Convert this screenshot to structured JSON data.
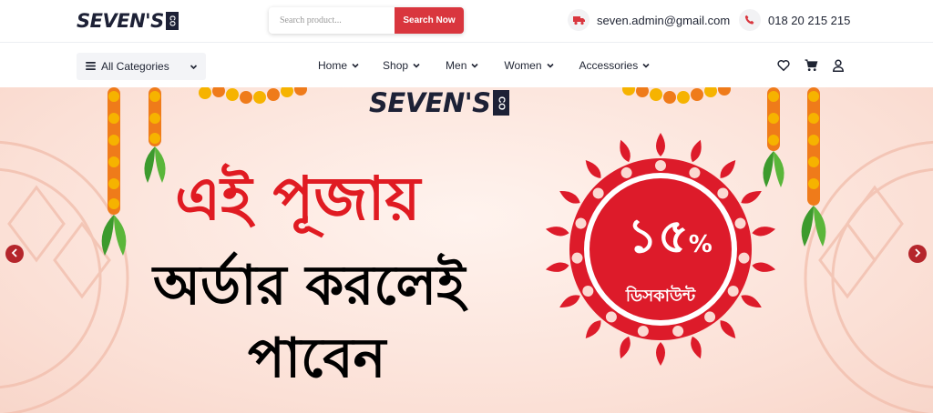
{
  "brand": {
    "name": "SEVEN'S",
    "suffix": "CO"
  },
  "search": {
    "placeholder": "Search product...",
    "value": "",
    "button_label": "Search Now"
  },
  "contact": {
    "email": "seven.admin@gmail.com",
    "phone": "018 20 215 215"
  },
  "nav": {
    "categories_label": "All Categories",
    "menu": [
      {
        "label": "Home"
      },
      {
        "label": "Shop"
      },
      {
        "label": "Men"
      },
      {
        "label": "Women"
      },
      {
        "label": "Accessories"
      }
    ],
    "icons": [
      "heart-icon",
      "cart-icon",
      "user-icon"
    ]
  },
  "hero": {
    "logo": "SEVEN'S",
    "logo_suffix": "CO",
    "headline": "এই পূজায়",
    "line2": "অর্ডার করলেই",
    "line3": "পাবেন",
    "discount_value": "১৫",
    "discount_symbol": "%",
    "discount_label": "ডিসকাউন্ট"
  },
  "colors": {
    "accent": "#d9363e",
    "headline": "#e01b22",
    "badge": "#dd1b2a",
    "text": "#1f2433",
    "hero_bg": "#fbe0d6"
  }
}
